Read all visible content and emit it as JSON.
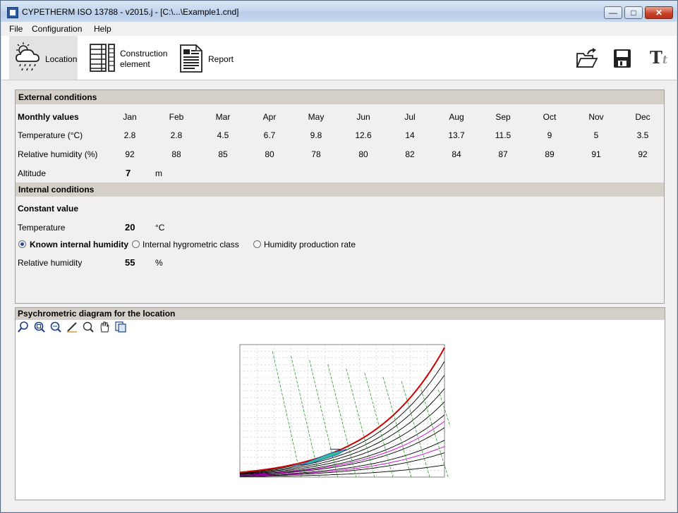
{
  "window": {
    "title": "CYPETHERM ISO 13788 - v2015.j - [C:\\...\\Example1.cnd]",
    "min_glyph": "—",
    "max_glyph": "□",
    "close_glyph": "✕"
  },
  "menu": {
    "file": "File",
    "configuration": "Configuration",
    "help": "Help"
  },
  "toolbar": {
    "location": "Location",
    "construction_line1": "Construction",
    "construction_line2": "element",
    "report": "Report",
    "open_icon": "open-folder-icon",
    "save_icon": "save-icon",
    "font_icon": "font-icon",
    "font_glyph": "T",
    "font_glyph_small": "t"
  },
  "external": {
    "header": "External conditions",
    "monthly_label": "Monthly values",
    "months": [
      "Jan",
      "Feb",
      "Mar",
      "Apr",
      "May",
      "Jun",
      "Jul",
      "Aug",
      "Sep",
      "Oct",
      "Nov",
      "Dec"
    ],
    "temperature_label": "Temperature (°C)",
    "temperatures": [
      "2.8",
      "2.8",
      "4.5",
      "6.7",
      "9.8",
      "12.6",
      "14",
      "13.7",
      "11.5",
      "9",
      "5",
      "3.5"
    ],
    "humidity_label": "Relative humidity (%)",
    "humidities": [
      "92",
      "88",
      "85",
      "80",
      "78",
      "80",
      "82",
      "84",
      "87",
      "89",
      "91",
      "92"
    ],
    "altitude_label": "Altitude",
    "altitude_value": "7",
    "altitude_unit": "m"
  },
  "internal": {
    "header": "Internal conditions",
    "constant_label": "Constant value",
    "temperature_label": "Temperature",
    "temperature_value": "20",
    "temperature_unit": "°C",
    "option_known": "Known internal humidity",
    "option_class": "Internal hygrometric class",
    "option_rate": "Humidity production rate",
    "selected_option": "Known internal humidity",
    "rh_label": "Relative humidity",
    "rh_value": "55",
    "rh_unit": "%"
  },
  "diagram": {
    "header": "Psychrometric diagram for the location",
    "tools": [
      "zoom-select-icon",
      "zoom-extents-icon",
      "zoom-window-icon",
      "pen-icon",
      "zoom-out-icon",
      "pan-hand-icon",
      "copy-icon"
    ],
    "colors": {
      "saturation": "#cc0000",
      "rh_lines": "#000000",
      "enthalpy_lines": "#cc00cc",
      "wetbulb_lines": "#2e9a2e",
      "zone_fill": "#1fbfa0",
      "zone_edge": "#2244aa"
    }
  }
}
